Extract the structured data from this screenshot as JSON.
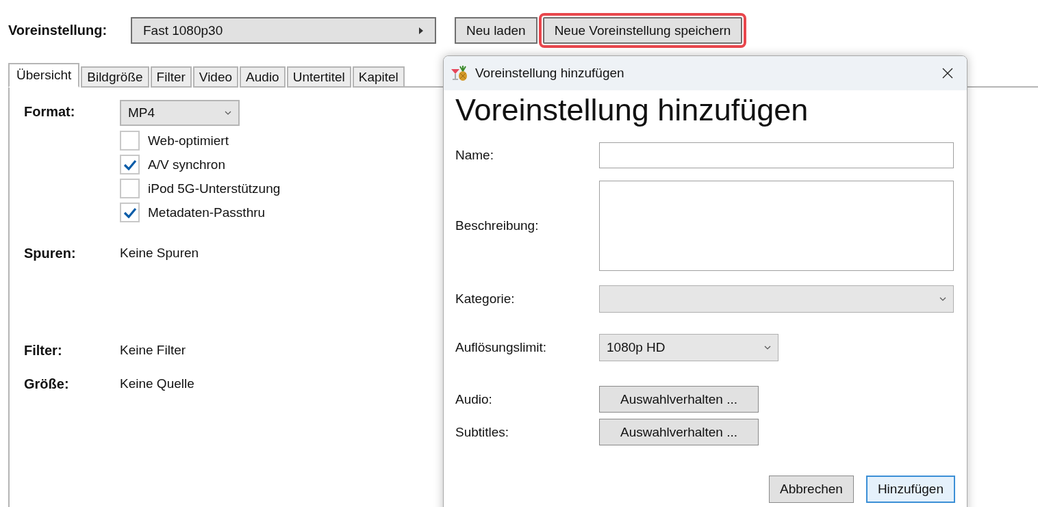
{
  "preset": {
    "label": "Voreinstellung:",
    "value": "Fast 1080p30"
  },
  "buttons": [
    {
      "label": "Neu laden",
      "highlighted": false
    },
    {
      "label": "Neue Voreinstellung speichern",
      "highlighted": true
    }
  ],
  "tabs": [
    {
      "label": "Übersicht",
      "selected": true
    },
    {
      "label": "Bildgröße",
      "selected": false
    },
    {
      "label": "Filter",
      "selected": false
    },
    {
      "label": "Video",
      "selected": false
    },
    {
      "label": "Audio",
      "selected": false
    },
    {
      "label": "Untertitel",
      "selected": false
    },
    {
      "label": "Kapitel",
      "selected": false
    }
  ],
  "summary": {
    "format": {
      "label": "Format:",
      "value": "MP4"
    },
    "options": [
      {
        "label": "Web-optimiert",
        "checked": false
      },
      {
        "label": "A/V synchron",
        "checked": true
      },
      {
        "label": "iPod 5G-Unterstützung",
        "checked": false
      },
      {
        "label": "Metadaten-Passthru",
        "checked": true
      }
    ],
    "rows": [
      {
        "label": "Spuren:",
        "value": "Keine Spuren"
      },
      {
        "label": "Filter:",
        "value": "Keine Filter"
      },
      {
        "label": "Größe:",
        "value": "Keine Quelle"
      }
    ]
  },
  "dialog": {
    "title": "Voreinstellung hinzufügen",
    "heading": "Voreinstellung hinzufügen",
    "fields": [
      {
        "kind": "text",
        "label": "Name:"
      },
      {
        "kind": "textarea",
        "label": "Beschreibung:"
      },
      {
        "kind": "select",
        "label": "Kategorie:"
      },
      {
        "kind": "dropdown",
        "label": "Auflösungslimit:",
        "value": "1080p HD"
      },
      {
        "kind": "button",
        "label": "Audio:",
        "value": "Auswahlverhalten ..."
      },
      {
        "kind": "button",
        "label": "Subtitles:",
        "value": "Auswahlverhalten ..."
      }
    ],
    "actions": [
      {
        "label": "Abbrechen",
        "default": false
      },
      {
        "label": "Hinzufügen",
        "default": true
      }
    ]
  }
}
